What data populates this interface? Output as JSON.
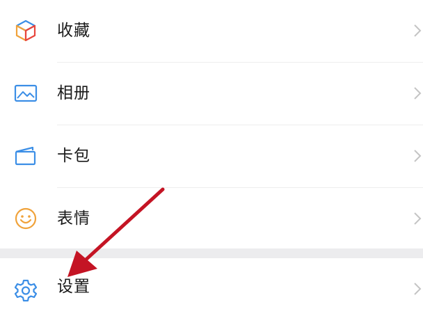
{
  "menu": {
    "items": [
      {
        "label": "收藏",
        "icon": "favorites-cube-icon"
      },
      {
        "label": "相册",
        "icon": "album-picture-icon"
      },
      {
        "label": "卡包",
        "icon": "card-wallet-icon"
      },
      {
        "label": "表情",
        "icon": "emoji-smiley-icon"
      }
    ],
    "settings": {
      "label": "设置",
      "icon": "gear-icon"
    }
  },
  "colors": {
    "icon_blue": "#3b8ee6",
    "icon_orange": "#f0a23a",
    "arrow_red": "#c41424",
    "chevron": "#c4c4c4"
  }
}
